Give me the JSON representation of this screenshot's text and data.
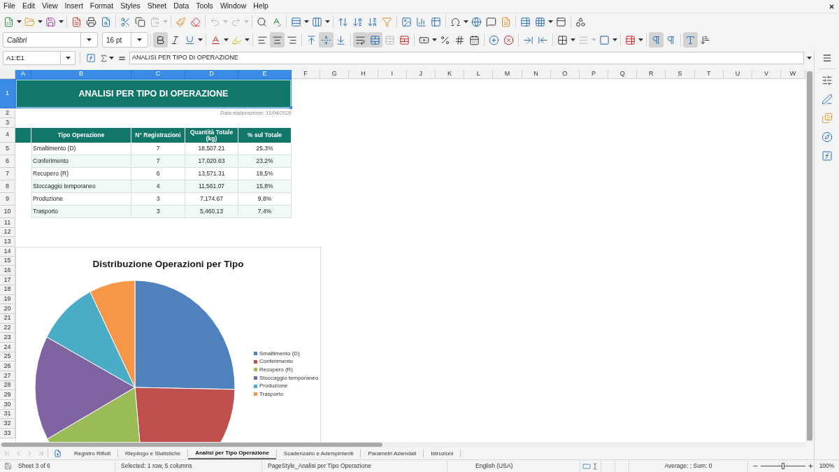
{
  "menu_bar": {
    "items": [
      "File",
      "Edit",
      "View",
      "Insert",
      "Format",
      "Styles",
      "Sheet",
      "Data",
      "Tools",
      "Window",
      "Help"
    ]
  },
  "standard_toolbar": {
    "paste_disabled": true,
    "undo_disabled": true,
    "redo_disabled": true
  },
  "formatting_toolbar": {
    "font_name": "Calibri",
    "font_size": "16 pt",
    "bold": true,
    "italic": false,
    "underline": false,
    "align_left": false,
    "align_center": true,
    "align_right": false,
    "align_top": false,
    "align_middle": true,
    "align_bottom": false,
    "wrap_text": true,
    "merge_and_center": true,
    "merge_cells_disabled": true,
    "left_to_right": true,
    "horizontal_text": true
  },
  "formula_bar": {
    "name_box": "A1:E1",
    "formula": "ANALISI PER TIPO DI OPERAZIONE"
  },
  "sheet": {
    "columns": [
      {
        "label": "A",
        "selected": true
      },
      {
        "label": "B",
        "selected": true
      },
      {
        "label": "C",
        "selected": true
      },
      {
        "label": "D",
        "selected": true
      },
      {
        "label": "E",
        "selected": true
      },
      {
        "label": "F",
        "selected": false
      },
      {
        "label": "G",
        "selected": false
      },
      {
        "label": "H",
        "selected": false
      },
      {
        "label": "I",
        "selected": false
      },
      {
        "label": "J",
        "selected": false
      },
      {
        "label": "K",
        "selected": false
      },
      {
        "label": "L",
        "selected": false
      },
      {
        "label": "M",
        "selected": false
      },
      {
        "label": "N",
        "selected": false
      },
      {
        "label": "O",
        "selected": false
      },
      {
        "label": "P",
        "selected": false
      },
      {
        "label": "Q",
        "selected": false
      },
      {
        "label": "R",
        "selected": false
      },
      {
        "label": "S",
        "selected": false
      },
      {
        "label": "T",
        "selected": false
      },
      {
        "label": "U",
        "selected": false
      },
      {
        "label": "V",
        "selected": false
      },
      {
        "label": "W",
        "selected": false
      }
    ],
    "rows": [
      {
        "label": "1",
        "selected": true
      },
      {
        "label": "2",
        "selected": false
      },
      {
        "label": "3",
        "selected": false
      },
      {
        "label": "4",
        "selected": false
      },
      {
        "label": "5",
        "selected": false
      },
      {
        "label": "6",
        "selected": false
      },
      {
        "label": "7",
        "selected": false
      },
      {
        "label": "8",
        "selected": false
      },
      {
        "label": "9",
        "selected": false
      },
      {
        "label": "10",
        "selected": false
      },
      {
        "label": "11",
        "selected": false
      },
      {
        "label": "12",
        "selected": false
      },
      {
        "label": "13",
        "selected": false
      },
      {
        "label": "14",
        "selected": false
      },
      {
        "label": "15",
        "selected": false
      },
      {
        "label": "16",
        "selected": false
      },
      {
        "label": "17",
        "selected": false
      },
      {
        "label": "18",
        "selected": false
      },
      {
        "label": "19",
        "selected": false
      },
      {
        "label": "20",
        "selected": false
      },
      {
        "label": "21",
        "selected": false
      },
      {
        "label": "22",
        "selected": false
      },
      {
        "label": "23",
        "selected": false
      },
      {
        "label": "24",
        "selected": false
      },
      {
        "label": "25",
        "selected": false
      },
      {
        "label": "26",
        "selected": false
      },
      {
        "label": "27",
        "selected": false
      },
      {
        "label": "28",
        "selected": false
      },
      {
        "label": "29",
        "selected": false
      },
      {
        "label": "30",
        "selected": false
      },
      {
        "label": "31",
        "selected": false
      },
      {
        "label": "32",
        "selected": false
      },
      {
        "label": "33",
        "selected": false
      }
    ],
    "title": "ANALISI PER TIPO DI OPERAZIONE",
    "date_note": "Data elaborazione: 11/04/2026",
    "table": {
      "columns": [
        "Tipo Operazione",
        "N° Registrazioni",
        "Quantità Totale (kg)",
        "% sul Totale"
      ],
      "rows": [
        {
          "cells": [
            "Smaltimento (D)",
            "7",
            "18,507.21",
            "25,3%"
          ]
        },
        {
          "cells": [
            "Conferimento",
            "7",
            "17,020.63",
            "23,2%"
          ]
        },
        {
          "cells": [
            "Recupero (R)",
            "6",
            "13,571.31",
            "18,5%"
          ]
        },
        {
          "cells": [
            "Stoccaggio temporaneo",
            "4",
            "11,561.07",
            "15,8%"
          ]
        },
        {
          "cells": [
            "Produzione",
            "3",
            "7,174.67",
            "9,8%"
          ]
        },
        {
          "cells": [
            "Trasporto",
            "3",
            "5,460.13",
            "7,4%"
          ]
        }
      ]
    },
    "chart": {
      "chart_data": {
        "type": "pie",
        "title": "Distribuzione Operazioni per Tipo",
        "categories": [
          "Smaltimento (D)",
          "Conferimento",
          "Recupero (R)",
          "Stoccaggio temporaneo",
          "Produzione",
          "Trasporto"
        ],
        "values": [
          25.3,
          23.2,
          18.5,
          15.8,
          9.8,
          7.4
        ],
        "colors": [
          "#4f81bd",
          "#c0504d",
          "#9bbb59",
          "#8064a2",
          "#4bacc6",
          "#f79646"
        ],
        "legend": "right"
      }
    }
  },
  "sheet_tabs": [
    {
      "label": "Registro Rifiuti",
      "selected": false
    },
    {
      "label": "Riepilogo e Statistiche",
      "selected": false
    },
    {
      "label": "Analisi per Tipo Operazione",
      "selected": true
    },
    {
      "label": "Scadenzario e Adempimenti",
      "selected": false
    },
    {
      "label": "Parametri Aziendali",
      "selected": false
    },
    {
      "label": "Istruzioni",
      "selected": false
    }
  ],
  "status_bar": {
    "sheet": "Sheet 3 of 6",
    "selection": "Selected: 1 row, 5 columns",
    "page_style": "PageStyle_Analisi per Tipo Operazione",
    "language": "English (USA)",
    "summary": "Average: ; Sum: 0",
    "zoom": {
      "level": 0.5,
      "reading": "100%"
    }
  }
}
